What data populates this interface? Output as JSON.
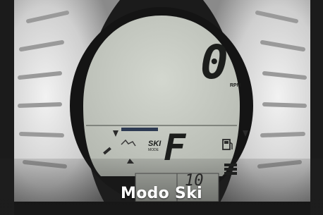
{
  "caption": "Modo Ski",
  "display": {
    "rpm_value": "0",
    "rpm_unit": "RPM",
    "mode_label": "SKI",
    "mode_sub": "MODE",
    "fuel_gauge_letter": "F",
    "odometer_value": "10"
  },
  "colors": {
    "lcd_background": "#c9cdc6",
    "lcd_segment": "#1c1e1c",
    "bezel": "#1a1a1a",
    "side_housing": "#d6d6d6",
    "indicator_bar": "#2d3a52"
  }
}
